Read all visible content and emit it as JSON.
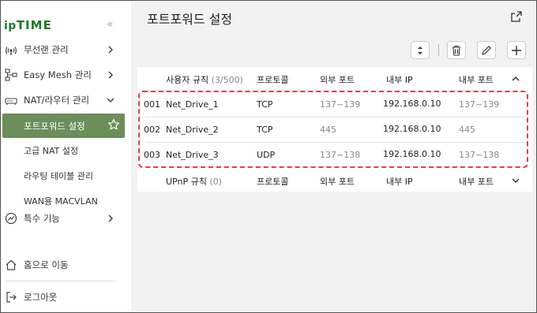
{
  "brand": {
    "ip": "ip",
    "time": "TIME"
  },
  "sidebar": {
    "collapse_glyph": "«",
    "items": [
      {
        "label": "무선랜 관리",
        "icon": "wifi-icon"
      },
      {
        "label": "Easy Mesh 관리",
        "icon": "mesh-network-icon"
      },
      {
        "label": "NAT/라우터 관리",
        "icon": "router-icon"
      },
      {
        "label": "포트포워드 설정"
      },
      {
        "label": "고급 NAT 설정"
      },
      {
        "label": "라우팅 테이블 관리"
      },
      {
        "label": "WAN용 MACVLAN"
      },
      {
        "label": "특수 기능",
        "icon": "special-feature-icon"
      },
      {
        "label": "홈으로 이동",
        "icon": "home-icon"
      },
      {
        "label": "로그아웃",
        "icon": "logout-icon"
      }
    ]
  },
  "main": {
    "title": "포트포워드 설정",
    "rules_header": {
      "name": "사용자 규칙",
      "count": "(3/500)",
      "protocol": "프로토콜",
      "ext_port": "외부 포트",
      "int_ip": "내부 IP",
      "int_port": "내부 포트"
    },
    "rules": [
      {
        "no": "001",
        "name": "Net_Drive_1",
        "protocol": "TCP",
        "ext_port": "137~139",
        "int_ip": "192.168.0.10",
        "int_port": "137~139"
      },
      {
        "no": "002",
        "name": "Net_Drive_2",
        "protocol": "TCP",
        "ext_port": "445",
        "int_ip": "192.168.0.10",
        "int_port": "445"
      },
      {
        "no": "003",
        "name": "Net_Drive_3",
        "protocol": "UDP",
        "ext_port": "137~138",
        "int_ip": "192.168.0.10",
        "int_port": "137~138"
      }
    ],
    "upnp_header": {
      "name": "UPnP 규칙",
      "count": "(0)",
      "protocol": "프로토콜",
      "ext_port": "외부 포트",
      "int_ip": "내부 IP",
      "int_port": "내부 포트"
    }
  },
  "colors": {
    "brand_green": "#1e7a26",
    "active_bg": "#6b8e5a",
    "highlight_dash": "#e83a4a"
  }
}
